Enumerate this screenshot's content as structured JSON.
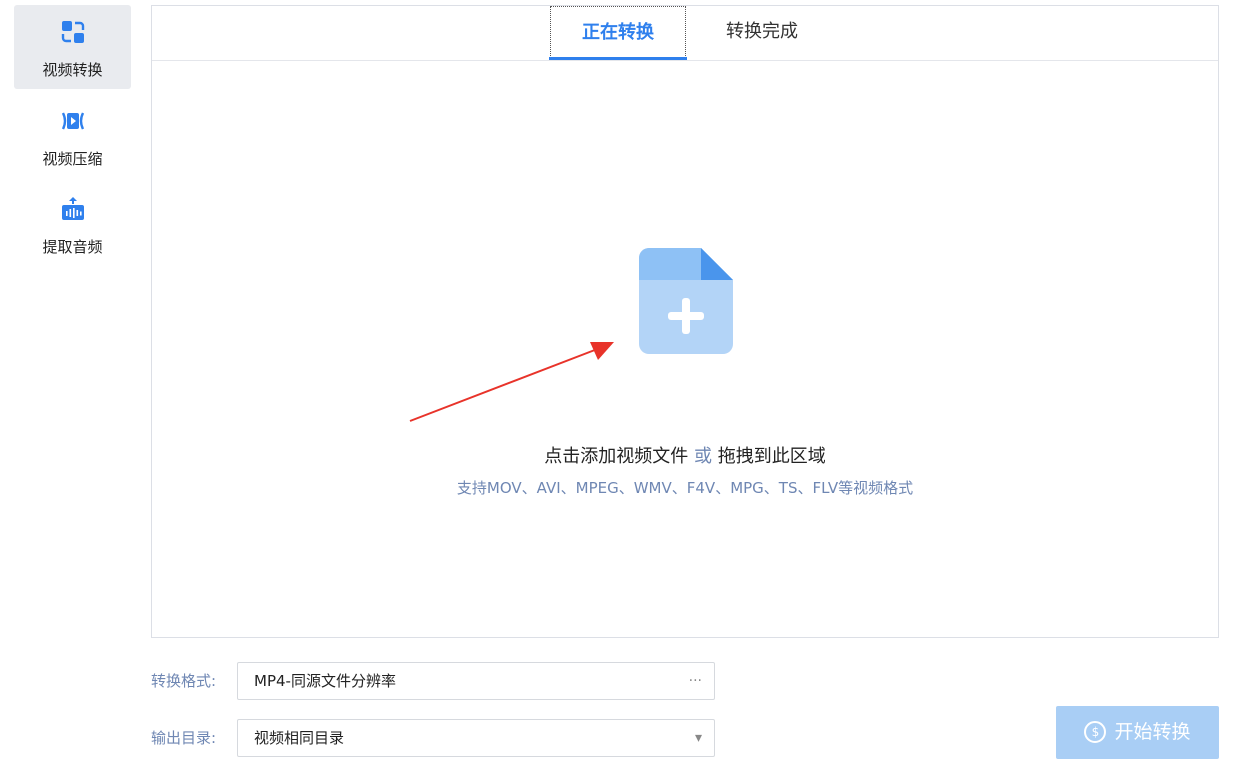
{
  "sidebar": {
    "items": [
      {
        "label": "视频转换",
        "icon": "convert-icon",
        "active": true
      },
      {
        "label": "视频压缩",
        "icon": "compress-icon",
        "active": false
      },
      {
        "label": "提取音频",
        "icon": "audio-extract-icon",
        "active": false
      }
    ]
  },
  "tabs": {
    "converting": "正在转换",
    "done": "转换完成"
  },
  "drop_zone": {
    "title_prefix": "点击添加视频文件",
    "title_or": "或",
    "title_suffix": "拖拽到此区域",
    "subtitle": "支持MOV、AVI、MPEG、WMV、F4V、MPG、TS、FLV等视频格式",
    "icon": "add-file-icon"
  },
  "form": {
    "format_label": "转换格式:",
    "format_value": "MP4-同源文件分辨率",
    "format_suffix": "···",
    "output_label": "输出目录:",
    "output_value": "视频相同目录",
    "output_suffix": "▾"
  },
  "start_button": {
    "label": "开始转换",
    "icon_glyph": "$"
  },
  "colors": {
    "accent": "#2f80ed",
    "start_button_bg": "#a9cef5",
    "icon_blue": "#2f80ed",
    "file_icon_light": "#b3d4f7",
    "file_icon_mid": "#7fb6f2",
    "annotation_arrow": "#e8332a"
  }
}
